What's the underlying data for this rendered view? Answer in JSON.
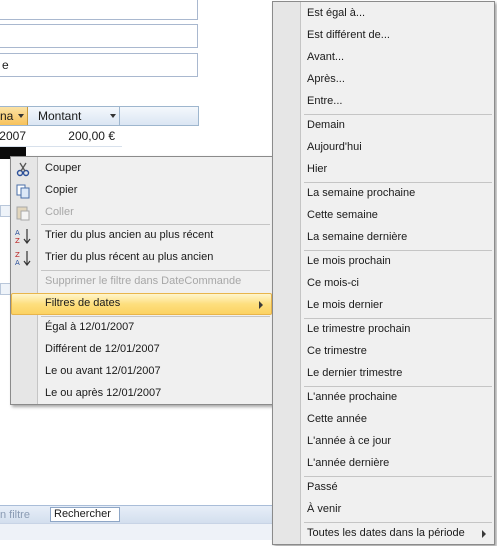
{
  "form": {
    "field3_value": "e",
    "grid": {
      "col_date_header": "na",
      "col_montant_header": "Montant",
      "row1_date": "2007",
      "row1_montant": "200,00 €"
    },
    "status": {
      "filter_label": "n filtre",
      "search_label": "Rechercher"
    }
  },
  "context_menu": {
    "items": {
      "couper": "Couper",
      "copier": "Copier",
      "coller": "Coller",
      "sort_asc": "Trier du plus ancien au plus récent",
      "sort_desc": "Trier du plus récent au plus ancien",
      "remove_filter": "Supprimer le filtre dans DateCommande",
      "date_filters": "Filtres de dates",
      "egal": "Égal à 12/01/2007",
      "different": "Différent de 12/01/2007",
      "le_ou_avant": "Le ou avant 12/01/2007",
      "le_ou_apres": "Le ou après 12/01/2007"
    }
  },
  "date_filter_submenu": {
    "items": [
      "Est égal à...",
      "Est différent de...",
      "Avant...",
      "Après...",
      "Entre...",
      "Demain",
      "Aujourd'hui",
      "Hier",
      "La semaine prochaine",
      "Cette semaine",
      "La semaine dernière",
      "Le mois prochain",
      "Ce mois-ci",
      "Le mois dernier",
      "Le trimestre prochain",
      "Ce trimestre",
      "Le dernier trimestre",
      "L'année prochaine",
      "Cette année",
      "L'année à ce jour",
      "L'année dernière",
      "Passé",
      "À venir",
      "Toutes les dates dans la période"
    ]
  }
}
